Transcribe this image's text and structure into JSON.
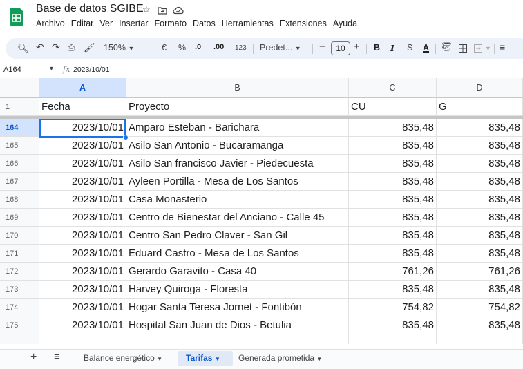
{
  "app": {
    "title": "Base de datos SGIBE",
    "icons": [
      "star-icon",
      "move-to-folder-icon",
      "cloud-status-icon"
    ],
    "menu": [
      "Archivo",
      "Editar",
      "Ver",
      "Insertar",
      "Formato",
      "Datos",
      "Herramientas",
      "Extensiones",
      "Ayuda"
    ]
  },
  "toolbar": {
    "zoom": "150%",
    "currency": "€",
    "percent": "%",
    "dec_decrease": ".0",
    "dec_increase": ".00",
    "number_format": "123",
    "font": "Predet...",
    "minus": "−",
    "font_size": "10",
    "plus": "+",
    "bold": "B",
    "italic": "I",
    "strike": "S",
    "text_color": "A"
  },
  "formula_bar": {
    "name_box": "A164",
    "fx": "fx",
    "value": "2023/10/01"
  },
  "columns": [
    "A",
    "B",
    "C",
    "D"
  ],
  "header_row": {
    "num": "1",
    "cells": [
      "Fecha",
      "Proyecto",
      "CU",
      "G"
    ]
  },
  "rows": [
    {
      "num": "164",
      "fecha": "2023/10/01",
      "proyecto": "Amparo Esteban - Barichara",
      "cu": "835,48",
      "g": "835,48"
    },
    {
      "num": "165",
      "fecha": "2023/10/01",
      "proyecto": "Asilo San Antonio - Bucaramanga",
      "cu": "835,48",
      "g": "835,48"
    },
    {
      "num": "166",
      "fecha": "2023/10/01",
      "proyecto": "Asilo San francisco Javier - Piedecuesta",
      "cu": "835,48",
      "g": "835,48"
    },
    {
      "num": "167",
      "fecha": "2023/10/01",
      "proyecto": "Ayleen Portilla - Mesa de Los Santos",
      "cu": "835,48",
      "g": "835,48"
    },
    {
      "num": "168",
      "fecha": "2023/10/01",
      "proyecto": "Casa Monasterio",
      "cu": "835,48",
      "g": "835,48"
    },
    {
      "num": "169",
      "fecha": "2023/10/01",
      "proyecto": "Centro de Bienestar del Anciano - Calle 45",
      "cu": "835,48",
      "g": "835,48"
    },
    {
      "num": "170",
      "fecha": "2023/10/01",
      "proyecto": "Centro San Pedro Claver - San Gil",
      "cu": "835,48",
      "g": "835,48"
    },
    {
      "num": "171",
      "fecha": "2023/10/01",
      "proyecto": "Eduard Castro - Mesa de Los Santos",
      "cu": "835,48",
      "g": "835,48"
    },
    {
      "num": "172",
      "fecha": "2023/10/01",
      "proyecto": "Gerardo Garavito - Casa 40",
      "cu": "761,26",
      "g": "761,26"
    },
    {
      "num": "173",
      "fecha": "2023/10/01",
      "proyecto": "Harvey Quiroga - Floresta",
      "cu": "835,48",
      "g": "835,48"
    },
    {
      "num": "174",
      "fecha": "2023/10/01",
      "proyecto": "Hogar Santa Teresa Jornet - Fontibón",
      "cu": "754,82",
      "g": "754,82"
    },
    {
      "num": "175",
      "fecha": "2023/10/01",
      "proyecto": "Hospital San Juan de Dios - Betulia",
      "cu": "835,48",
      "g": "835,48"
    }
  ],
  "sheets": {
    "add": "+",
    "all_sheets": "≡",
    "tabs": [
      {
        "label": "Balance energético",
        "active": false
      },
      {
        "label": "Tarifas",
        "active": true
      },
      {
        "label": "Generada prometida",
        "active": false
      }
    ]
  },
  "colors": {
    "accent": "#1a73e8",
    "selection": "#d3e3fd",
    "toolbar_bg": "#edf2fa",
    "sheets_green": "#0f9d58"
  }
}
